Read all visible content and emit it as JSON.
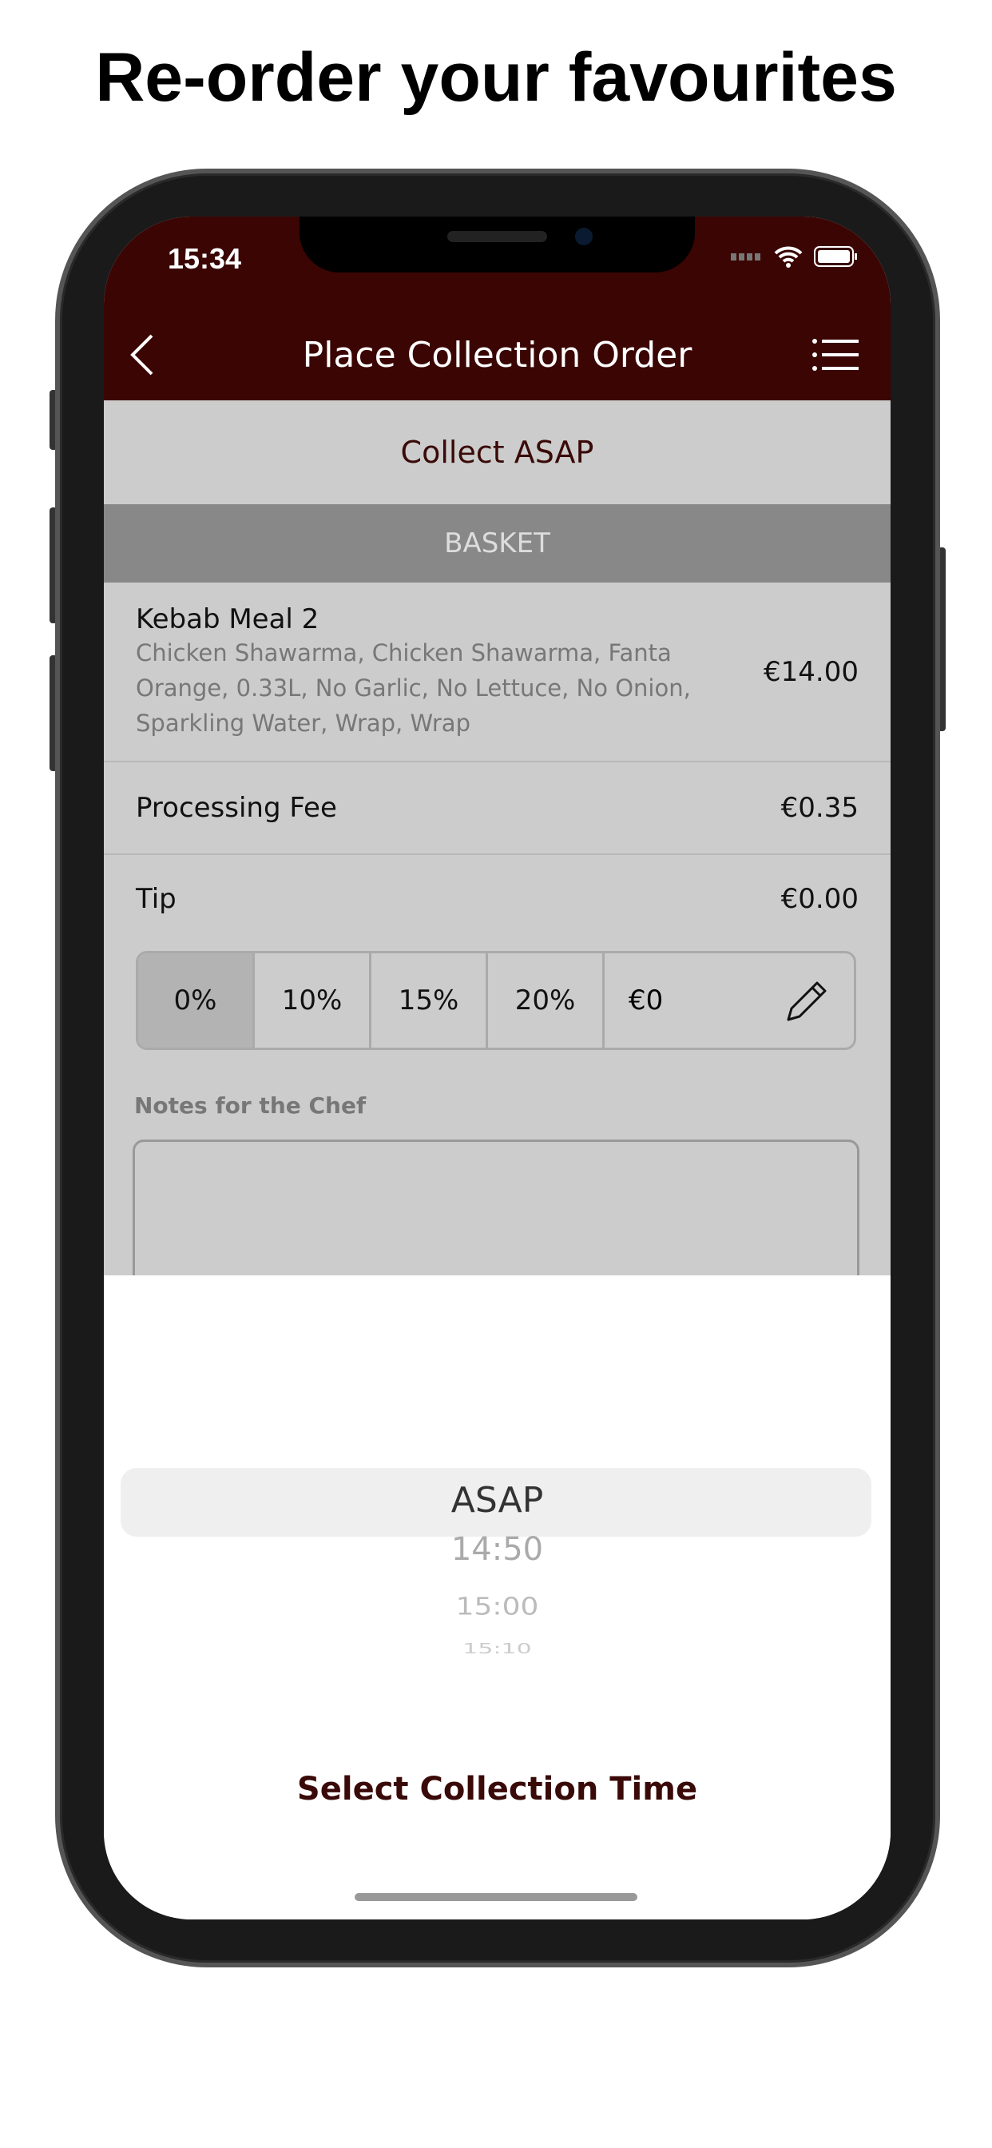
{
  "headline": "Re-order your favourites",
  "status": {
    "time": "15:34"
  },
  "header": {
    "title": "Place Collection Order"
  },
  "collect_label": "Collect ASAP",
  "basket_label": "BASKET",
  "items": [
    {
      "title": "Kebab Meal 2",
      "desc": "Chicken Shawarma, Chicken Shawarma, Fanta Orange, 0.33L, No Garlic, No Lettuce, No Onion, Sparkling Water, Wrap, Wrap",
      "price": "€14.00"
    }
  ],
  "fee": {
    "label": "Processing Fee",
    "value": "€0.35"
  },
  "tip": {
    "label": "Tip",
    "value": "€0.00",
    "options": [
      "0%",
      "10%",
      "15%",
      "20%"
    ],
    "selected": "0%",
    "custom": "€0"
  },
  "notes": {
    "label": "Notes for the Chef",
    "value": ""
  },
  "picker": {
    "options": [
      "ASAP",
      "14:50",
      "15:00",
      "15:10"
    ],
    "selected": "ASAP",
    "title": "Select Collection Time"
  },
  "colors": {
    "brand": "#3a0503",
    "accent_text": "#3a0a08"
  }
}
